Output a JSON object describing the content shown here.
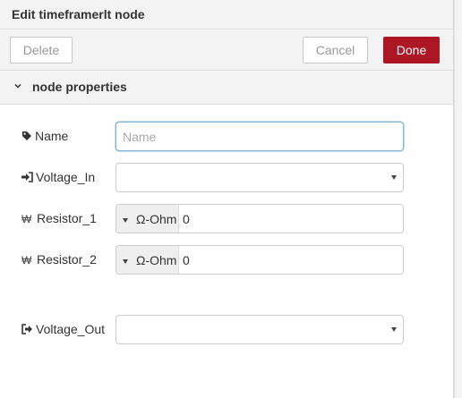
{
  "dialog": {
    "title": "Edit timeframerlt node"
  },
  "toolbar": {
    "delete_label": "Delete",
    "cancel_label": "Cancel",
    "done_label": "Done"
  },
  "section": {
    "label": "node properties"
  },
  "fields": {
    "name": {
      "label": "Name",
      "placeholder": "Name",
      "value": ""
    },
    "voltage_in": {
      "label": "Voltage_In",
      "value": ""
    },
    "resistor_1": {
      "label": "Resistor_1",
      "type": "Ω-Ohm",
      "value": "0"
    },
    "resistor_2": {
      "label": "Resistor_2",
      "type": "Ω-Ohm",
      "value": "0"
    },
    "voltage_out": {
      "label": "Voltage_Out",
      "value": ""
    }
  },
  "icons": {
    "resistor_icon_glyph": "₩",
    "name_icon": "tag-icon",
    "voltage_in_icon": "sign-in-icon",
    "voltage_out_icon": "sign-out-icon"
  },
  "colors": {
    "done": "#ad1625",
    "focus": "#85b7d9"
  }
}
